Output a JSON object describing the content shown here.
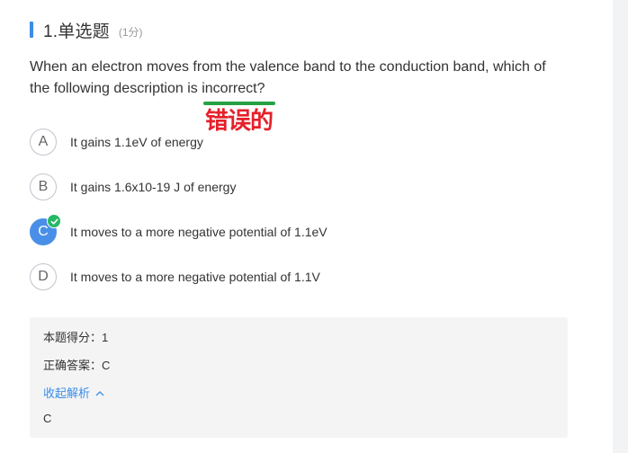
{
  "question": {
    "number_title": "1.单选题",
    "score": "(1分)",
    "text": "When an electron moves from the valence band to the conduction band, which of the following description is incorrect?"
  },
  "annotation": {
    "text": "错误的",
    "underline_color": "#25a244",
    "text_color": "#e5202a"
  },
  "options": [
    {
      "letter": "A",
      "text": "It gains 1.1eV of energy",
      "selected": false
    },
    {
      "letter": "B",
      "text": "It gains 1.6x10-19 J of energy",
      "selected": false
    },
    {
      "letter": "C",
      "text": "It moves to a more negative potential of 1.1eV",
      "selected": true
    },
    {
      "letter": "D",
      "text": "It moves to a more negative potential of 1.1V",
      "selected": false
    }
  ],
  "analysis": {
    "score_line": "本题得分：1",
    "answer_line": "正确答案：C",
    "collapse_label": "收起解析",
    "explanation": "C"
  },
  "colors": {
    "accent": "#3a8ee6",
    "selected": "#4a8fe7",
    "correct": "#25b864"
  },
  "icons": {
    "check": "check-icon",
    "collapse": "chevron-up-icon"
  }
}
